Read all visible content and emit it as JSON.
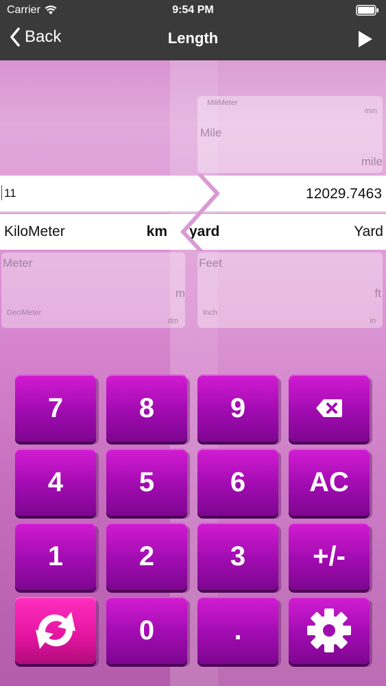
{
  "status": {
    "carrier": "Carrier",
    "time": "9:54 PM"
  },
  "nav": {
    "back_label": "Back",
    "title": "Length"
  },
  "picker": {
    "left": {
      "value": "11",
      "selected_unit_name": "KiloMeter",
      "selected_unit_symbol": "km",
      "below1_name": "Meter",
      "below1_symbol": "m",
      "below2_name": "DeciMeter",
      "below2_symbol": "dm"
    },
    "right": {
      "value": "12029.7463",
      "selected_unit_symbol": "yard",
      "selected_unit_name": "Yard",
      "above2_name": "MiliMeter",
      "above2_symbol": "mm",
      "above1_name": "Mile",
      "above1_symbol": "mile",
      "below1_name": "Feet",
      "below1_symbol": "ft",
      "below2_name": "Inch",
      "below2_symbol": "in"
    }
  },
  "keypad": {
    "k7": "7",
    "k8": "8",
    "k9": "9",
    "k4": "4",
    "k5": "5",
    "k6": "6",
    "ac": "AC",
    "k1": "1",
    "k2": "2",
    "k3": "3",
    "plusminus": "+/-",
    "k0": "0",
    "dot": "."
  },
  "icons": {
    "backspace": "backspace-icon",
    "swap": "swap-icon",
    "settings": "gear-icon",
    "play": "play-icon"
  }
}
